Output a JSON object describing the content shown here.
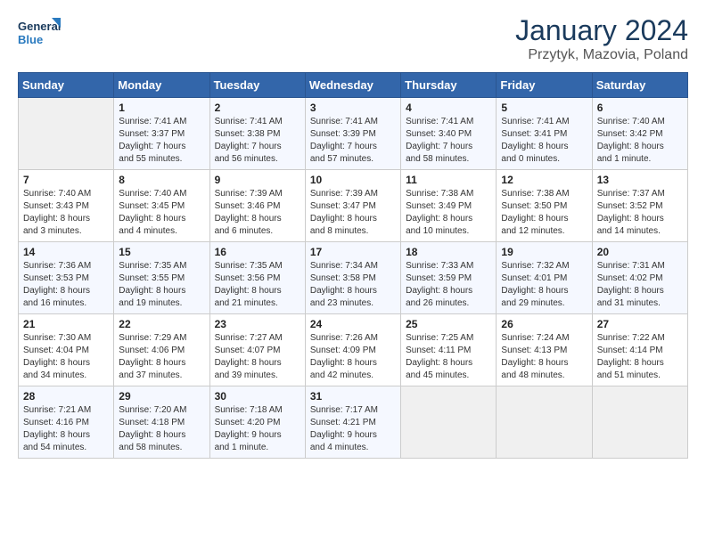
{
  "logo": {
    "line1": "General",
    "line2": "Blue"
  },
  "title": "January 2024",
  "subtitle": "Przytyk, Mazovia, Poland",
  "days_header": [
    "Sunday",
    "Monday",
    "Tuesday",
    "Wednesday",
    "Thursday",
    "Friday",
    "Saturday"
  ],
  "weeks": [
    [
      {
        "day": "",
        "info": ""
      },
      {
        "day": "1",
        "info": "Sunrise: 7:41 AM\nSunset: 3:37 PM\nDaylight: 7 hours\nand 55 minutes."
      },
      {
        "day": "2",
        "info": "Sunrise: 7:41 AM\nSunset: 3:38 PM\nDaylight: 7 hours\nand 56 minutes."
      },
      {
        "day": "3",
        "info": "Sunrise: 7:41 AM\nSunset: 3:39 PM\nDaylight: 7 hours\nand 57 minutes."
      },
      {
        "day": "4",
        "info": "Sunrise: 7:41 AM\nSunset: 3:40 PM\nDaylight: 7 hours\nand 58 minutes."
      },
      {
        "day": "5",
        "info": "Sunrise: 7:41 AM\nSunset: 3:41 PM\nDaylight: 8 hours\nand 0 minutes."
      },
      {
        "day": "6",
        "info": "Sunrise: 7:40 AM\nSunset: 3:42 PM\nDaylight: 8 hours\nand 1 minute."
      }
    ],
    [
      {
        "day": "7",
        "info": "Sunrise: 7:40 AM\nSunset: 3:43 PM\nDaylight: 8 hours\nand 3 minutes."
      },
      {
        "day": "8",
        "info": "Sunrise: 7:40 AM\nSunset: 3:45 PM\nDaylight: 8 hours\nand 4 minutes."
      },
      {
        "day": "9",
        "info": "Sunrise: 7:39 AM\nSunset: 3:46 PM\nDaylight: 8 hours\nand 6 minutes."
      },
      {
        "day": "10",
        "info": "Sunrise: 7:39 AM\nSunset: 3:47 PM\nDaylight: 8 hours\nand 8 minutes."
      },
      {
        "day": "11",
        "info": "Sunrise: 7:38 AM\nSunset: 3:49 PM\nDaylight: 8 hours\nand 10 minutes."
      },
      {
        "day": "12",
        "info": "Sunrise: 7:38 AM\nSunset: 3:50 PM\nDaylight: 8 hours\nand 12 minutes."
      },
      {
        "day": "13",
        "info": "Sunrise: 7:37 AM\nSunset: 3:52 PM\nDaylight: 8 hours\nand 14 minutes."
      }
    ],
    [
      {
        "day": "14",
        "info": "Sunrise: 7:36 AM\nSunset: 3:53 PM\nDaylight: 8 hours\nand 16 minutes."
      },
      {
        "day": "15",
        "info": "Sunrise: 7:35 AM\nSunset: 3:55 PM\nDaylight: 8 hours\nand 19 minutes."
      },
      {
        "day": "16",
        "info": "Sunrise: 7:35 AM\nSunset: 3:56 PM\nDaylight: 8 hours\nand 21 minutes."
      },
      {
        "day": "17",
        "info": "Sunrise: 7:34 AM\nSunset: 3:58 PM\nDaylight: 8 hours\nand 23 minutes."
      },
      {
        "day": "18",
        "info": "Sunrise: 7:33 AM\nSunset: 3:59 PM\nDaylight: 8 hours\nand 26 minutes."
      },
      {
        "day": "19",
        "info": "Sunrise: 7:32 AM\nSunset: 4:01 PM\nDaylight: 8 hours\nand 29 minutes."
      },
      {
        "day": "20",
        "info": "Sunrise: 7:31 AM\nSunset: 4:02 PM\nDaylight: 8 hours\nand 31 minutes."
      }
    ],
    [
      {
        "day": "21",
        "info": "Sunrise: 7:30 AM\nSunset: 4:04 PM\nDaylight: 8 hours\nand 34 minutes."
      },
      {
        "day": "22",
        "info": "Sunrise: 7:29 AM\nSunset: 4:06 PM\nDaylight: 8 hours\nand 37 minutes."
      },
      {
        "day": "23",
        "info": "Sunrise: 7:27 AM\nSunset: 4:07 PM\nDaylight: 8 hours\nand 39 minutes."
      },
      {
        "day": "24",
        "info": "Sunrise: 7:26 AM\nSunset: 4:09 PM\nDaylight: 8 hours\nand 42 minutes."
      },
      {
        "day": "25",
        "info": "Sunrise: 7:25 AM\nSunset: 4:11 PM\nDaylight: 8 hours\nand 45 minutes."
      },
      {
        "day": "26",
        "info": "Sunrise: 7:24 AM\nSunset: 4:13 PM\nDaylight: 8 hours\nand 48 minutes."
      },
      {
        "day": "27",
        "info": "Sunrise: 7:22 AM\nSunset: 4:14 PM\nDaylight: 8 hours\nand 51 minutes."
      }
    ],
    [
      {
        "day": "28",
        "info": "Sunrise: 7:21 AM\nSunset: 4:16 PM\nDaylight: 8 hours\nand 54 minutes."
      },
      {
        "day": "29",
        "info": "Sunrise: 7:20 AM\nSunset: 4:18 PM\nDaylight: 8 hours\nand 58 minutes."
      },
      {
        "day": "30",
        "info": "Sunrise: 7:18 AM\nSunset: 4:20 PM\nDaylight: 9 hours\nand 1 minute."
      },
      {
        "day": "31",
        "info": "Sunrise: 7:17 AM\nSunset: 4:21 PM\nDaylight: 9 hours\nand 4 minutes."
      },
      {
        "day": "",
        "info": ""
      },
      {
        "day": "",
        "info": ""
      },
      {
        "day": "",
        "info": ""
      }
    ]
  ]
}
